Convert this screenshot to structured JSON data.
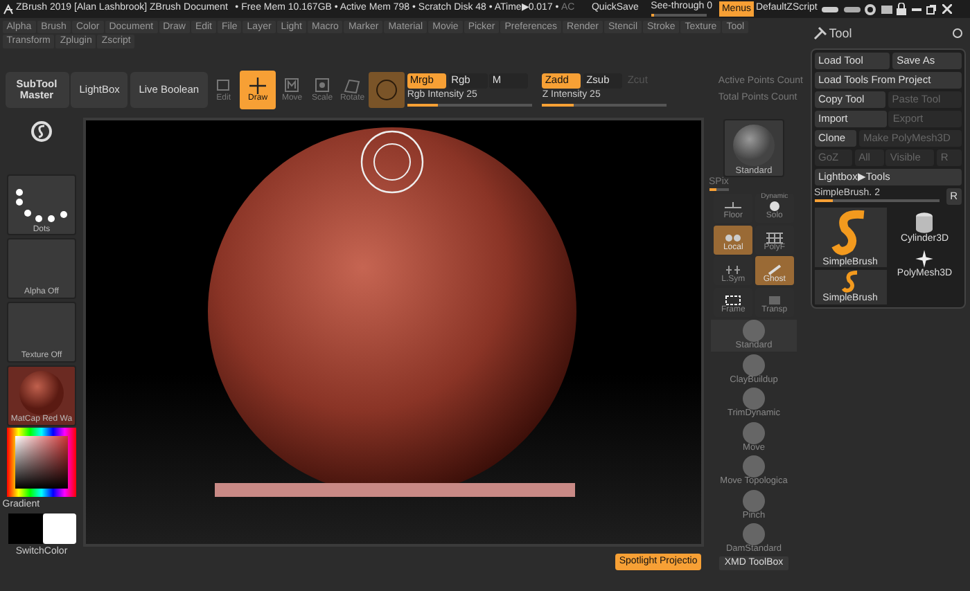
{
  "title_bar": {
    "title": "ZBrush 2019 [Alan Lashbrook]  ZBrush Document",
    "stats": "• Free Mem 10.167GB • Active Mem 798 • Scratch Disk 48 • ATime▶0.017 •",
    "stats_tail": "AC",
    "quicksave": "QuickSave",
    "see_through": {
      "label": "See-through  0",
      "level": 0.05
    },
    "menus_toggle": {
      "label": "Menus",
      "on": true
    },
    "script": "DefaultZScript"
  },
  "menus": [
    [
      "Alpha",
      "Brush",
      "Color",
      "Document",
      "Draw",
      "Edit",
      "File",
      "Layer",
      "Light",
      "Macro",
      "Marker",
      "Material",
      "Movie",
      "Picker",
      "Preferences",
      "Render",
      "Stencil",
      "Stroke",
      "Texture",
      "Tool"
    ],
    [
      "Transform",
      "Zplugin",
      "Zscript"
    ]
  ],
  "toolbar": {
    "buttons": [
      "SubTool Master",
      "LightBox",
      "Live Boolean"
    ],
    "transform": [
      {
        "kind": "edit",
        "label": "Edit",
        "selected": false
      },
      {
        "kind": "draw",
        "label": "Draw",
        "selected": true
      },
      {
        "kind": "move",
        "label": "Move",
        "selected": false
      },
      {
        "kind": "scale",
        "label": "Scale",
        "selected": false
      },
      {
        "kind": "rotate",
        "label": "Rotate",
        "selected": false
      }
    ],
    "rgb_modes": [
      {
        "label": "Mrgb",
        "selected": true,
        "disabled": false
      },
      {
        "label": "Rgb",
        "selected": false,
        "disabled": false
      },
      {
        "label": "M",
        "selected": false,
        "disabled": false
      }
    ],
    "z_modes": [
      {
        "label": "Zadd",
        "selected": true,
        "disabled": false
      },
      {
        "label": "Zsub",
        "selected": false,
        "disabled": false
      },
      {
        "label": "Zcut",
        "selected": false,
        "disabled": true
      }
    ],
    "sliders": [
      {
        "label": "Rgb Intensity 25",
        "level": 0.25
      },
      {
        "label": "Z Intensity 25",
        "level": 0.25
      }
    ],
    "counts": [
      "Active Points Count",
      "Total Points Count"
    ]
  },
  "left_shelf": {
    "items": [
      {
        "kind": "dots",
        "label": "Dots"
      },
      {
        "kind": "blank",
        "label": "Alpha Off"
      },
      {
        "kind": "blank",
        "label": "Texture Off"
      },
      {
        "kind": "matcap",
        "label": "MatCap Red Wa"
      }
    ],
    "gradient": "Gradient",
    "switch": "SwitchColor"
  },
  "right_shelf": {
    "material": "Standard",
    "spix": {
      "label": "SPix",
      "level": 0.4
    },
    "toggles": [
      {
        "kind": "floor",
        "label": "Floor",
        "on": false
      },
      {
        "kind": "local",
        "label": "Local",
        "on": true
      },
      {
        "kind": "lsym",
        "label": "L.Sym",
        "on": false
      },
      {
        "kind": "frame",
        "label": "Frame",
        "on": false
      },
      {
        "kind": "solo",
        "label": "Solo",
        "caption": "Dynamic",
        "on": false
      },
      {
        "kind": "polyf",
        "label": "PolyF",
        "on": false
      },
      {
        "kind": "ghost",
        "label": "Ghost",
        "on": true
      },
      {
        "kind": "transp",
        "label": "Transp",
        "on": false
      }
    ],
    "brushes": [
      "Standard",
      "ClayBuildup",
      "TrimDynamic",
      "Move",
      "Move Topologica",
      "Pinch",
      "DamStandard"
    ],
    "toolbox": "XMD ToolBox"
  },
  "spotlight": "Spotlight Projectio",
  "tool_palette": {
    "title": "Tool",
    "rows": [
      [
        {
          "label": "Load Tool",
          "disabled": false
        },
        {
          "label": "Save As",
          "disabled": false
        }
      ],
      [
        {
          "label": "Load Tools From Project",
          "disabled": false
        }
      ],
      [
        {
          "label": "Copy Tool",
          "disabled": false
        },
        {
          "label": "Paste Tool",
          "disabled": true
        }
      ],
      [
        {
          "label": "Import",
          "disabled": false
        },
        {
          "label": "Export",
          "disabled": true
        }
      ],
      [
        {
          "label": "Clone",
          "disabled": false
        },
        {
          "label": "Make PolyMesh3D",
          "disabled": true
        }
      ],
      [
        {
          "label": "GoZ",
          "disabled": true
        },
        {
          "label": "All",
          "disabled": true
        },
        {
          "label": "Visible",
          "disabled": true
        },
        {
          "label": "R",
          "disabled": true
        }
      ],
      [
        {
          "label": "Lightbox▶Tools",
          "disabled": false
        }
      ]
    ],
    "slider": {
      "label": "SimpleBrush. 2",
      "level": 0.15,
      "reset": "R"
    },
    "thumbs": [
      {
        "kind": "s-large",
        "label": "SimpleBrush"
      },
      {
        "kind": "s-small",
        "label": "SimpleBrush"
      },
      {
        "kind": "cylinder",
        "label": "Cylinder3D"
      },
      {
        "kind": "star",
        "label": "PolyMesh3D"
      }
    ]
  }
}
